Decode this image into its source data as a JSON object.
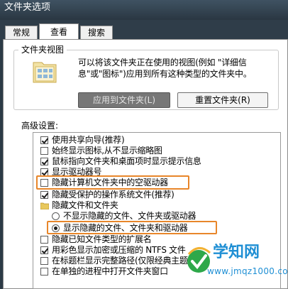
{
  "window": {
    "title": "文件夹选项"
  },
  "tabs": [
    {
      "label": "常规",
      "active": false
    },
    {
      "label": "查看",
      "active": true
    },
    {
      "label": "搜索",
      "active": false
    }
  ],
  "folder_view": {
    "legend": "文件夹视图",
    "description": "可以将该文件夹正在使用的视图(例如 \"详细信息\"或\"图标\")应用到所有这种类型的文件夹中。",
    "apply_button": "应用到文件夹(L)",
    "reset_button": "重置文件夹(R)"
  },
  "advanced": {
    "label": "高级设置:",
    "items": [
      {
        "type": "checkbox",
        "checked": true,
        "label": "使用共享向导(推荐)"
      },
      {
        "type": "checkbox",
        "checked": false,
        "label": "始终显示图标,从不显示缩略图"
      },
      {
        "type": "checkbox",
        "checked": true,
        "label": "鼠标指向文件夹和桌面项时显示提示信息"
      },
      {
        "type": "checkbox",
        "checked": true,
        "label": "显示驱动器号"
      },
      {
        "type": "checkbox",
        "checked": false,
        "label": "隐藏计算机文件夹中的空驱动器",
        "highlighted": true
      },
      {
        "type": "checkbox",
        "checked": true,
        "label": "隐藏受保护的操作系统文件(推荐)"
      },
      {
        "type": "folder",
        "label": "隐藏文件和文件夹"
      },
      {
        "type": "radio",
        "checked": false,
        "label": "不显示隐藏的文件、文件夹或驱动器"
      },
      {
        "type": "radio",
        "checked": true,
        "label": "显示隐藏的文件、文件夹和驱动器",
        "highlighted": true
      },
      {
        "type": "checkbox",
        "checked": false,
        "label": "隐藏已知文件类型的扩展名"
      },
      {
        "type": "checkbox",
        "checked": true,
        "label": "用彩色显示加密或压缩的 NTFS 文件"
      },
      {
        "type": "checkbox",
        "checked": false,
        "label": "在标题栏显示完整路径(仅限经典主题)"
      },
      {
        "type": "checkbox",
        "checked": false,
        "label": "在单独的进程中打开文件夹窗口"
      }
    ]
  },
  "watermark": {
    "name": "学知网",
    "url": "www.jmqz1000.com"
  },
  "colors": {
    "highlight": "#e8862a",
    "titlebar": "#2c3a46",
    "watermark": "#1f8fd4"
  }
}
